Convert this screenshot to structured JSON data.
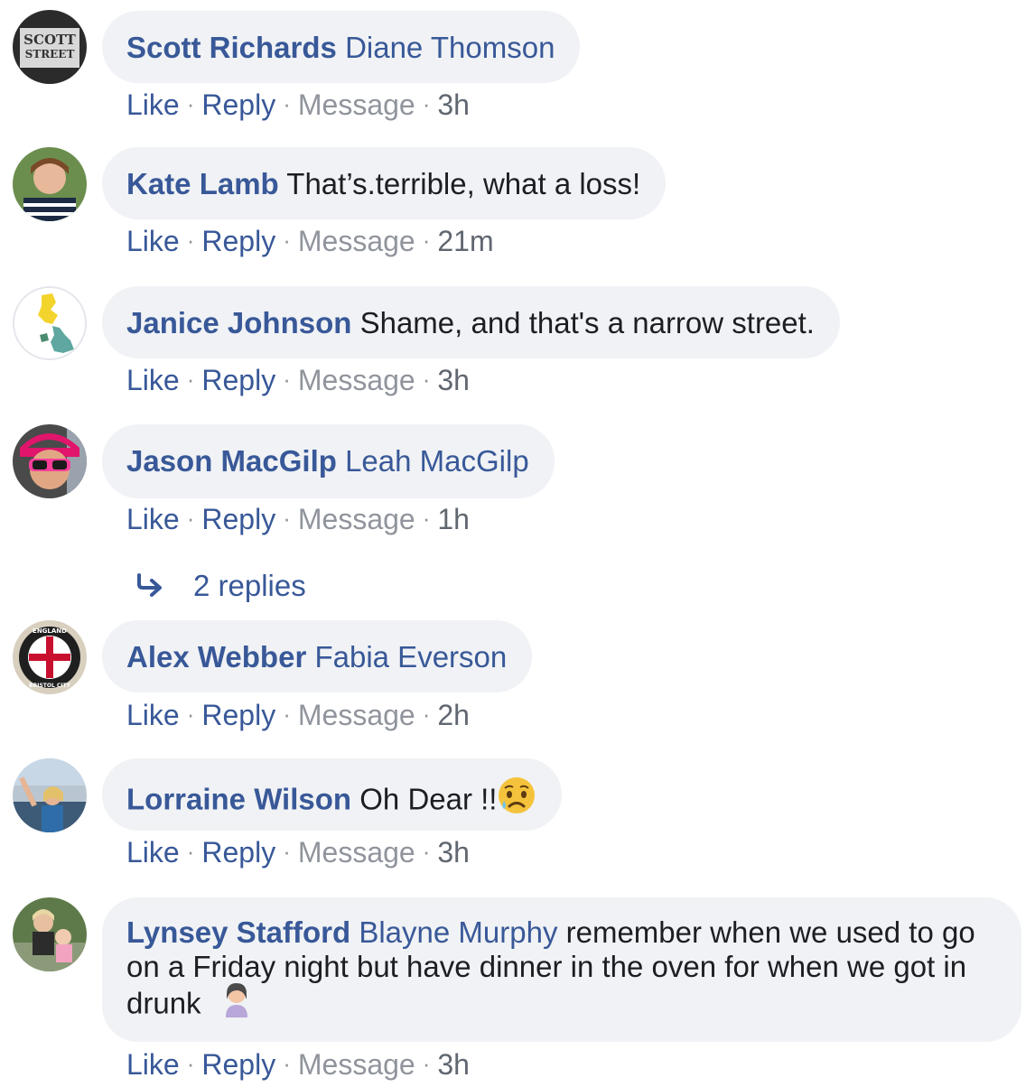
{
  "labels": {
    "like": "Like",
    "reply": "Reply",
    "message": "Message",
    "sep": "·"
  },
  "colors": {
    "link": "#385898",
    "bubble": "#f0f2f5",
    "muted": "#90949c"
  },
  "comments": [
    {
      "author": "Scott Richards",
      "tag": "Diane Thomson",
      "text": "",
      "time": "3h",
      "avatar_text": [
        "SCOTT",
        "STREET"
      ]
    },
    {
      "author": "Kate Lamb",
      "tag": "",
      "text": "That’s.terrible, what a loss!",
      "time": "21m"
    },
    {
      "author": "Janice Johnson",
      "tag": "",
      "text": "Shame, and that's a narrow street.",
      "time": "3h"
    },
    {
      "author": "Jason MacGilp",
      "tag": "Leah MacGilp",
      "text": "",
      "time": "1h"
    },
    {
      "author": "Alex Webber",
      "tag": "Fabia Everson",
      "text": "",
      "time": "2h",
      "avatar_text": [
        "ENGLAND",
        "BRISTOL CITY"
      ]
    },
    {
      "author": "Lorraine Wilson",
      "tag": "",
      "text": "Oh Dear !!",
      "time": "3h",
      "emoji": "sad-sweat-face-emoji"
    },
    {
      "author": "Lynsey Stafford",
      "tag": "Blayne Murphy",
      "text": "remember when we used to go on a Friday night but have dinner in the oven for when we got in drunk",
      "time": "3h",
      "emoji": "facepalm-woman-emoji"
    }
  ],
  "replies_link": {
    "label": "2 replies",
    "icon": "reply-arrow-icon"
  }
}
